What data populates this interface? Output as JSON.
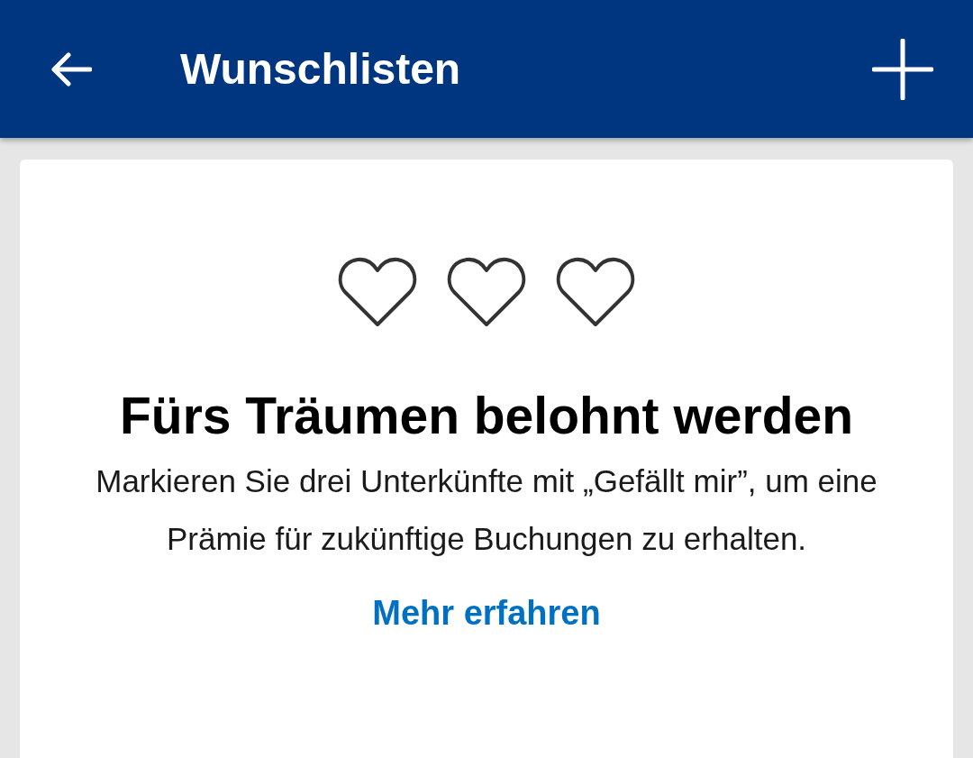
{
  "app_bar": {
    "title": "Wunschlisten"
  },
  "card": {
    "hearts": [
      {
        "filled": false
      },
      {
        "filled": false
      },
      {
        "filled": false
      }
    ],
    "heading": "Fürs Träumen belohnt werden",
    "body": "Markieren Sie drei Unterkünfte mit „Gefällt mir”, um eine Prämie für zukünftige Buchungen zu erhalten.",
    "link": "Mehr erfahren"
  }
}
